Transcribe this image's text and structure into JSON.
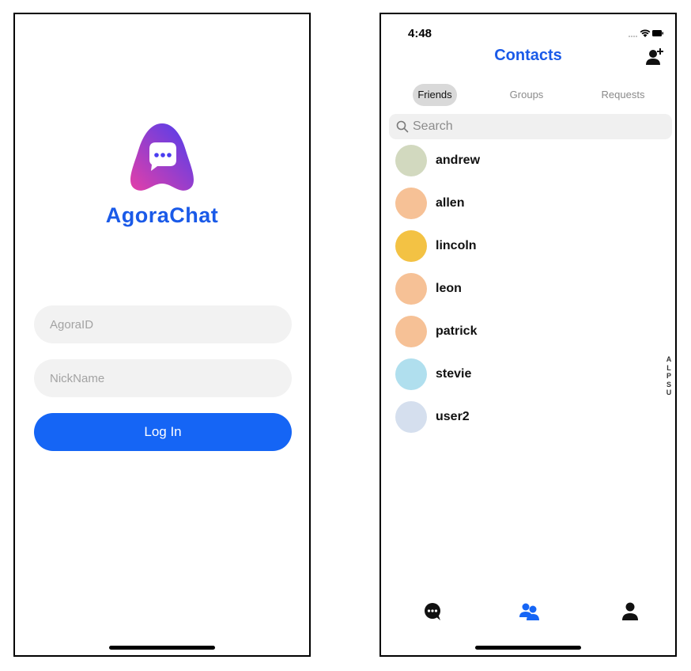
{
  "login": {
    "brand": "AgoraChat",
    "agora_id_placeholder": "AgoraID",
    "nickname_placeholder": "NickName",
    "login_label": "Log In"
  },
  "contacts": {
    "status_time": "4:48",
    "title": "Contacts",
    "tabs": [
      {
        "label": "Friends",
        "active": true
      },
      {
        "label": "Groups",
        "active": false
      },
      {
        "label": "Requests",
        "active": false
      }
    ],
    "search_placeholder": "Search",
    "list": [
      {
        "name": "andrew",
        "color": "#d2d9bf"
      },
      {
        "name": "allen",
        "color": "#f6c196"
      },
      {
        "name": "lincoln",
        "color": "#f3c244"
      },
      {
        "name": "leon",
        "color": "#f6c196"
      },
      {
        "name": "patrick",
        "color": "#f6c196"
      },
      {
        "name": "stevie",
        "color": "#b0dfee"
      },
      {
        "name": "user2",
        "color": "#d5dfee"
      }
    ],
    "index_letters": [
      "A",
      "L",
      "P",
      "S",
      "U"
    ],
    "nav": [
      {
        "icon": "chat-bubble-icon",
        "active": false
      },
      {
        "icon": "contacts-icon",
        "active": true
      },
      {
        "icon": "person-icon",
        "active": false
      }
    ]
  },
  "colors": {
    "brand_blue": "#1a5ae8",
    "button_blue": "#1565f5",
    "logo_gradient_start": "#e43fa8",
    "logo_gradient_end": "#4a3df0"
  }
}
